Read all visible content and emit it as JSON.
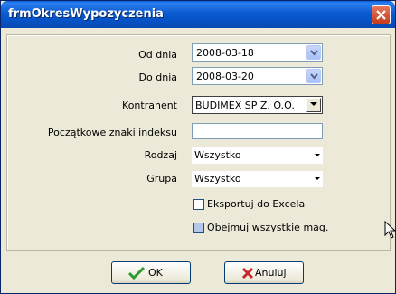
{
  "window": {
    "title": "frmOkresWypozyczenia"
  },
  "form": {
    "od_dnia": {
      "label": "Od dnia",
      "value": "2008-03-18"
    },
    "do_dnia": {
      "label": "Do dnia",
      "value": "2008-03-20"
    },
    "kontrahent": {
      "label": "Kontrahent",
      "value": "BUDIMEX SP Z. O.O."
    },
    "znaki_indeksu": {
      "label": "Początkowe znaki indeksu",
      "value": ""
    },
    "rodzaj": {
      "label": "Rodzaj",
      "value": "Wszystko"
    },
    "grupa": {
      "label": "Grupa",
      "value": "Wszystko"
    },
    "eksportuj": {
      "label": "Eksportuj do Excela",
      "checked": false
    },
    "obejmuj": {
      "label": "Obejmuj wszystkie mag.",
      "checked": false
    }
  },
  "buttons": {
    "ok": "OK",
    "anuluj": "Anuluj"
  },
  "icons": {
    "ok": "check-icon",
    "anuluj": "x-icon",
    "close": "close-icon"
  },
  "colors": {
    "titlebar": "#0a5fd8",
    "ok_icon": "#2e9b2e",
    "cancel_icon": "#c8282a"
  }
}
